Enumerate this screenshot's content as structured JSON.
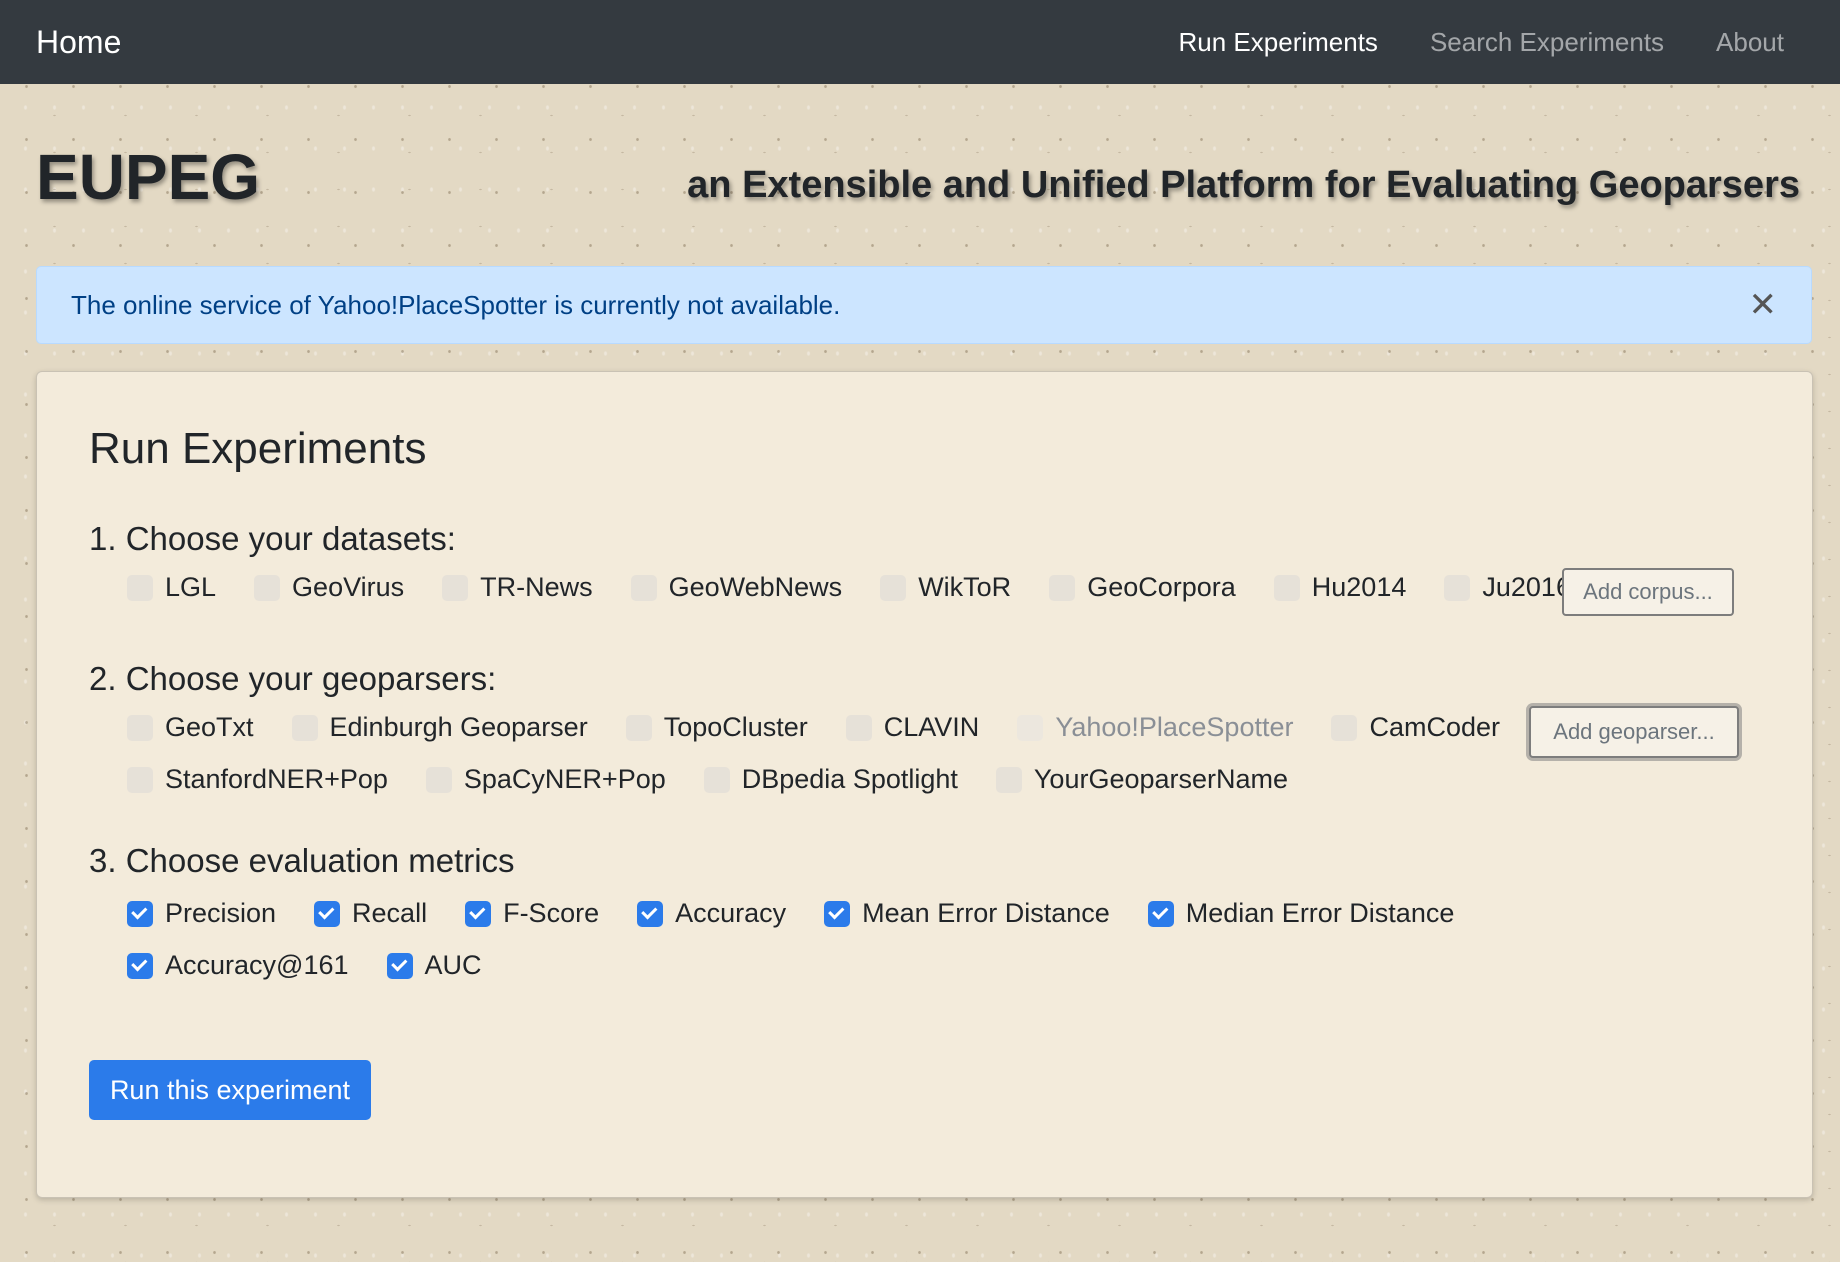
{
  "nav": {
    "brand": "Home",
    "links": [
      {
        "label": "Run Experiments",
        "active": true
      },
      {
        "label": "Search Experiments",
        "active": false
      },
      {
        "label": "About",
        "active": false
      }
    ]
  },
  "header": {
    "title": "EUPEG",
    "tagline": "an Extensible and Unified Platform for Evaluating Geoparsers"
  },
  "alert": {
    "message": "The online service of Yahoo!PlaceSpotter is currently not available.",
    "close_icon": "close-icon"
  },
  "main": {
    "title": "Run Experiments",
    "datasets": {
      "heading": "1. Choose your datasets:",
      "items": [
        {
          "label": "LGL",
          "checked": false
        },
        {
          "label": "GeoVirus",
          "checked": false
        },
        {
          "label": "TR-News",
          "checked": false
        },
        {
          "label": "GeoWebNews",
          "checked": false
        },
        {
          "label": "WikToR",
          "checked": false
        },
        {
          "label": "GeoCorpora",
          "checked": false
        },
        {
          "label": "Hu2014",
          "checked": false
        },
        {
          "label": "Ju2016",
          "checked": false
        }
      ],
      "add_button": "Add corpus..."
    },
    "geoparsers": {
      "heading": "2. Choose your geoparsers:",
      "items": [
        {
          "label": "GeoTxt",
          "checked": false,
          "disabled": false
        },
        {
          "label": "Edinburgh Geoparser",
          "checked": false,
          "disabled": false
        },
        {
          "label": "TopoCluster",
          "checked": false,
          "disabled": false
        },
        {
          "label": "CLAVIN",
          "checked": false,
          "disabled": false
        },
        {
          "label": "Yahoo!PlaceSpotter",
          "checked": false,
          "disabled": true
        },
        {
          "label": "CamCoder",
          "checked": false,
          "disabled": false
        },
        {
          "label": "StanfordNER+Pop",
          "checked": false,
          "disabled": false
        },
        {
          "label": "SpaCyNER+Pop",
          "checked": false,
          "disabled": false
        },
        {
          "label": "DBpedia Spotlight",
          "checked": false,
          "disabled": false
        },
        {
          "label": "YourGeoparserName",
          "checked": false,
          "disabled": false
        }
      ],
      "add_button": "Add geoparser..."
    },
    "metrics": {
      "heading": "3. Choose evaluation metrics",
      "items": [
        {
          "label": "Precision",
          "checked": true
        },
        {
          "label": "Recall",
          "checked": true
        },
        {
          "label": "F-Score",
          "checked": true
        },
        {
          "label": "Accuracy",
          "checked": true
        },
        {
          "label": "Mean Error Distance",
          "checked": true
        },
        {
          "label": "Median Error Distance",
          "checked": true
        },
        {
          "label": "Accuracy@161",
          "checked": true
        },
        {
          "label": "AUC",
          "checked": true
        }
      ]
    },
    "run_button": "Run this experiment"
  },
  "colors": {
    "navbar": "#343a40",
    "accent": "#2b7bea",
    "alert_bg": "#cce5ff",
    "alert_text": "#004085",
    "card_bg": "#f3ebdb"
  }
}
